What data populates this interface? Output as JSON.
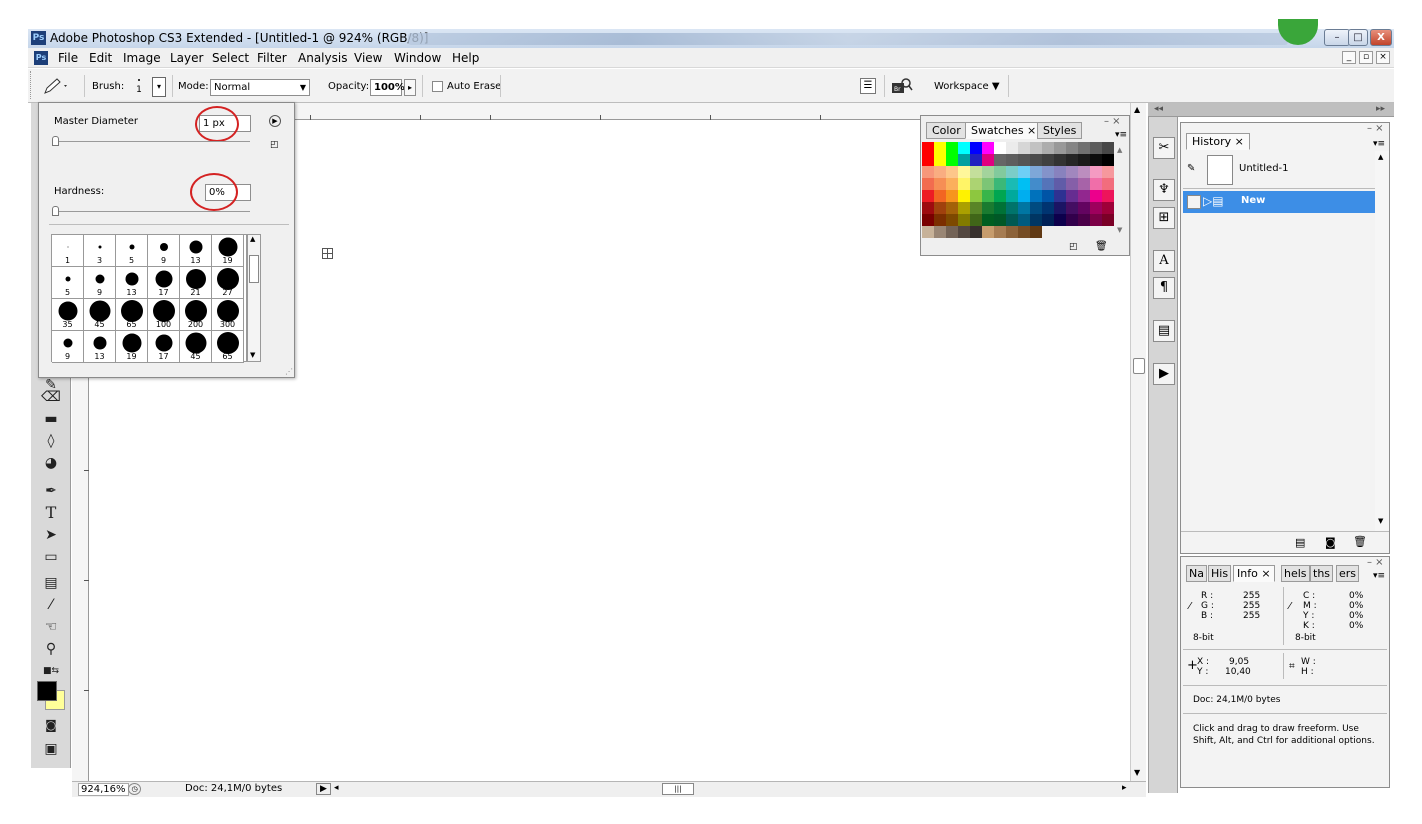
{
  "window": {
    "title": "Adobe Photoshop CS3 Extended - [Untitled-1 @ 924% (RGB/8)]",
    "app_icon": "Ps",
    "minimize": "–",
    "maximize": "□",
    "close": "X"
  },
  "menu": {
    "items": [
      "File",
      "Edit",
      "Image",
      "Layer",
      "Select",
      "Filter",
      "Analysis",
      "View",
      "Window",
      "Help"
    ],
    "doc_minimize": "_",
    "doc_restore": "▫",
    "doc_close": "×"
  },
  "options": {
    "brush_label": "Brush:",
    "brush_size": "1",
    "mode_label": "Mode:",
    "mode_value": "Normal",
    "opacity_label": "Opacity:",
    "opacity_value": "100%",
    "auto_erase_label": "Auto Erase",
    "workspace_label": "Workspace ▼"
  },
  "brush_picker": {
    "master_diameter_label": "Master Diameter",
    "master_diameter_value": "1 px",
    "hardness_label": "Hardness:",
    "hardness_value": "0%",
    "brushes": [
      {
        "label": "1",
        "size": 1
      },
      {
        "label": "3",
        "size": 3
      },
      {
        "label": "5",
        "size": 5
      },
      {
        "label": "9",
        "size": 8
      },
      {
        "label": "13",
        "size": 13
      },
      {
        "label": "19",
        "size": 19
      },
      {
        "label": "5",
        "size": 5
      },
      {
        "label": "9",
        "size": 9
      },
      {
        "label": "13",
        "size": 13
      },
      {
        "label": "17",
        "size": 17
      },
      {
        "label": "21",
        "size": 20
      },
      {
        "label": "27",
        "size": 22
      },
      {
        "label": "35",
        "size": 19
      },
      {
        "label": "45",
        "size": 21
      },
      {
        "label": "65",
        "size": 22
      },
      {
        "label": "100",
        "size": 22
      },
      {
        "label": "200",
        "size": 22
      },
      {
        "label": "300",
        "size": 22
      },
      {
        "label": "9",
        "size": 9
      },
      {
        "label": "13",
        "size": 13
      },
      {
        "label": "19",
        "size": 19
      },
      {
        "label": "17",
        "size": 17
      },
      {
        "label": "45",
        "size": 21
      },
      {
        "label": "65",
        "size": 22
      }
    ]
  },
  "statusbar": {
    "zoom": "924,16%",
    "doc": "Doc: 24,1M/0 bytes"
  },
  "swatches_panel": {
    "tabs": [
      "Color",
      "Swatches ×",
      "Styles"
    ],
    "colors": [
      "#ff0000",
      "#ffff00",
      "#00ff00",
      "#00ffff",
      "#0000ff",
      "#ff00ff",
      "#ffffff",
      "#ebebeb",
      "#d6d6d6",
      "#c2c2c2",
      "#adadad",
      "#999999",
      "#858585",
      "#707070",
      "#5c5c5c",
      "#474747",
      "#ff0000",
      "#ffff00",
      "#00ff00",
      "#00a0a0",
      "#2020c0",
      "#e00080",
      "#666666",
      "#5e5e5e",
      "#555555",
      "#4a4a4a",
      "#404040",
      "#333333",
      "#262626",
      "#1a1a1a",
      "#0d0d0d",
      "#000000",
      "#f7977a",
      "#f9ad81",
      "#fdc68a",
      "#fff79a",
      "#c4df9b",
      "#a3d39c",
      "#82ca9d",
      "#7bcdc8",
      "#6ecff6",
      "#7ea7d8",
      "#8493ca",
      "#8882be",
      "#a187be",
      "#bc8dbf",
      "#f49ac2",
      "#f6989d",
      "#f26c4f",
      "#f68e55",
      "#fbaf5c",
      "#fff467",
      "#acd372",
      "#7cc576",
      "#3bb878",
      "#1abbb4",
      "#00bff3",
      "#438ccb",
      "#5574b9",
      "#605ca8",
      "#855fa8",
      "#a763a8",
      "#f06ea9",
      "#f26d7d",
      "#ed1c24",
      "#f26522",
      "#f7941d",
      "#fff200",
      "#8dc73f",
      "#39b54a",
      "#00a651",
      "#00a99d",
      "#00aeef",
      "#0072bc",
      "#0054a6",
      "#2e3192",
      "#662d91",
      "#92278f",
      "#ec008c",
      "#ed145b",
      "#9e0b0f",
      "#a0410d",
      "#a36209",
      "#aba000",
      "#598527",
      "#1a7b30",
      "#007236",
      "#00746b",
      "#0076a3",
      "#004b80",
      "#003471",
      "#1b1464",
      "#440e62",
      "#630460",
      "#9e005d",
      "#9e0039",
      "#790000",
      "#7b2e00",
      "#7d4900",
      "#827b00",
      "#406618",
      "#005e20",
      "#005826",
      "#005952",
      "#005b7f",
      "#003663",
      "#002157",
      "#0d004c",
      "#32004b",
      "#4b0049",
      "#7b0046",
      "#7a0026",
      "#c7b299",
      "#998675",
      "#736357",
      "#534741",
      "#37302d",
      "#c69c6d",
      "#a67c52",
      "#8c6239",
      "#754c24",
      "#603913"
    ]
  },
  "history_panel": {
    "tab": "History ×",
    "snapshot": "Untitled-1",
    "state": "New"
  },
  "info_panel": {
    "tabs": [
      "Na",
      "His",
      "Info ×",
      "hels",
      "ths",
      "ers"
    ],
    "r_label": "R :",
    "r": "255",
    "g_label": "G :",
    "g": "255",
    "b_label": "B :",
    "b": "255",
    "c_label": "C :",
    "c": "0%",
    "m_label": "M :",
    "m": "0%",
    "y_label": "Y :",
    "y": "0%",
    "k_label": "K :",
    "k": "0%",
    "bit_left": "8-bit",
    "bit_right": "8-bit",
    "x_label": "X :",
    "x": "9,05",
    "y_coord_label": "Y :",
    "y_coord": "10,40",
    "w_label": "W :",
    "h_label": "H :",
    "doc": "Doc: 24,1M/0 bytes",
    "hint": "Click and drag to draw freeform.  Use Shift, Alt, and Ctrl for additional options."
  }
}
